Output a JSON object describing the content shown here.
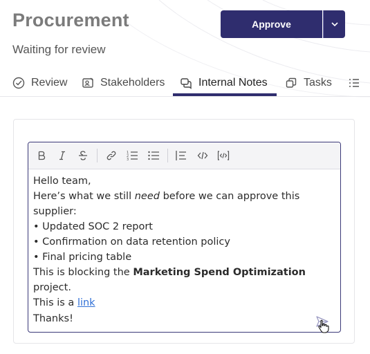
{
  "header": {
    "title": "Procurement",
    "subtitle": "Waiting for review",
    "approve_label": "Approve"
  },
  "tabs": [
    {
      "label": "Review",
      "icon": "check-circle-icon"
    },
    {
      "label": "Stakeholders",
      "icon": "person-card-icon"
    },
    {
      "label": "Internal Notes",
      "icon": "chat-bubbles-icon",
      "active": true
    },
    {
      "label": "Tasks",
      "icon": "copy-icon"
    },
    {
      "label": "",
      "icon": "list-icon"
    }
  ],
  "toolbar": [
    "bold-icon",
    "italic-icon",
    "strikethrough-icon",
    "link-icon",
    "ordered-list-icon",
    "bullet-list-icon",
    "blockquote-icon",
    "code-icon",
    "code-block-icon"
  ],
  "note": {
    "line1": "Hello team,",
    "line2_pre": "Here’s what we still ",
    "line2_em": "need",
    "line2_post": " before we can approve this",
    "line3": "supplier:",
    "bullet1": "• Updated SOC 2 report",
    "bullet2": "• Confirmation on data retention policy",
    "bullet3": "• Final pricing table",
    "line7_pre": "This is blocking the ",
    "line7_strong": "Marketing Spend Optimization",
    "line8": "project.",
    "line9_pre": "This is a ",
    "link_text": "link",
    "line10": "Thanks!"
  },
  "colors": {
    "primary": "#2f2d6e",
    "link": "#2f6fd6"
  }
}
